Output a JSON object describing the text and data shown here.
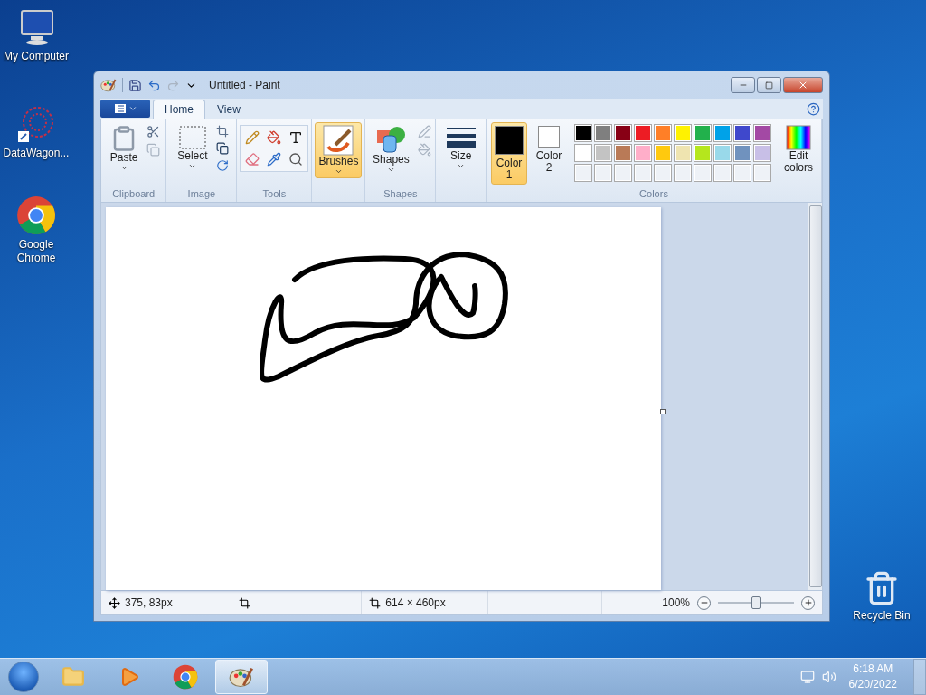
{
  "desktop_icons": [
    {
      "kind": "computer",
      "label": "My Computer"
    },
    {
      "kind": "shortcut-net",
      "label": "DataWagon..."
    },
    {
      "kind": "chrome",
      "label": "Google Chrome"
    },
    {
      "kind": "recycle",
      "label": "Recycle Bin"
    }
  ],
  "window": {
    "title": "Untitled - Paint",
    "tabs": [
      {
        "label": "Home",
        "selected": true
      },
      {
        "label": "View",
        "selected": false
      }
    ],
    "ribbon": {
      "clipboard": {
        "label": "Clipboard",
        "paste": "Paste"
      },
      "image": {
        "label": "Image",
        "select": "Select"
      },
      "tools": {
        "label": "Tools"
      },
      "brushes": {
        "label": "Brushes",
        "selected": true
      },
      "shapes": {
        "label": "Shapes",
        "button": "Shapes"
      },
      "size": {
        "label": "Size"
      },
      "colors": {
        "label": "Colors",
        "slots": [
          {
            "label": "Color 1",
            "color": "#000000",
            "selected": true
          },
          {
            "label": "Color 2",
            "color": "#ffffff",
            "selected": false
          }
        ],
        "palette": [
          {
            "color": "#000000"
          },
          {
            "color": "#7f7f7f"
          },
          {
            "color": "#880015"
          },
          {
            "color": "#ed1c24"
          },
          {
            "color": "#ff7f27"
          },
          {
            "color": "#fff200"
          },
          {
            "color": "#22b14c"
          },
          {
            "color": "#00a2e8"
          },
          {
            "color": "#3f48cc"
          },
          {
            "color": "#a349a4"
          },
          {
            "color": "#ffffff"
          },
          {
            "color": "#c3c3c3"
          },
          {
            "color": "#b97a57"
          },
          {
            "color": "#ffaec9"
          },
          {
            "color": "#ffc90e"
          },
          {
            "color": "#efe4b0"
          },
          {
            "color": "#b5e61d"
          },
          {
            "color": "#99d9ea"
          },
          {
            "color": "#7092be"
          },
          {
            "color": "#c8bfe7"
          }
        ],
        "edit": "Edit colors"
      }
    },
    "status_bar": {
      "position": "375, 83px",
      "size": "614 × 460px",
      "zoom": "100%",
      "zoom_slider": {
        "level": 0.5
      }
    }
  },
  "taskbar": {
    "items": [
      {
        "kind": "explorer",
        "selected": false
      },
      {
        "kind": "media",
        "selected": false
      },
      {
        "kind": "chrome",
        "selected": false
      },
      {
        "kind": "paint",
        "selected": true
      }
    ],
    "time": "6:18 AM",
    "date": "6/20/2022"
  }
}
